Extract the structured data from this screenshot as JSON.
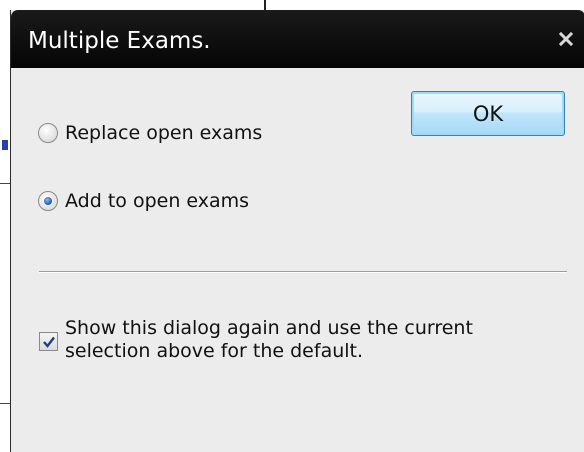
{
  "dialog": {
    "title": "Multiple Exams.",
    "close_glyph": "x",
    "ok_label": "OK",
    "options": [
      {
        "label": "Replace open exams",
        "selected": false
      },
      {
        "label": "Add to open exams",
        "selected": true
      }
    ],
    "checkbox": {
      "line1": "Show this dialog again and use the current",
      "line2": "selection above for the default.",
      "checked": true
    }
  },
  "icons": {
    "close": "close-icon",
    "checkmark": "checkmark-icon"
  },
  "colors": {
    "titlebar": "#0a0a0a",
    "dialog_bg": "#ececec",
    "ok_button_top": "#eaf6fd",
    "ok_button_bottom": "#a7d9f5",
    "radio_selected": "#1e5aa8",
    "check_color": "#1e3f8a"
  }
}
